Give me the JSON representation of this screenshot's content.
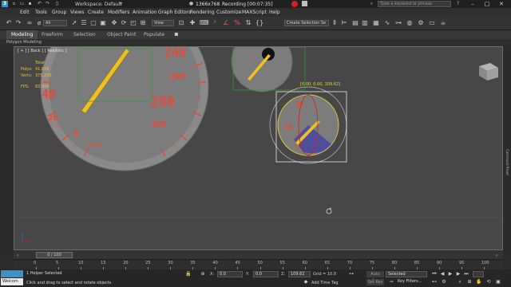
{
  "titlebar": {
    "app_icon": "3ds-max-logo",
    "workspace": "Workspace: Default",
    "recording_dims": "1366x768",
    "recording_status": "Recording [00:07:35]",
    "search_placeholder": "Type a keyword or phrase"
  },
  "menus": [
    "Edit",
    "Tools",
    "Group",
    "Views",
    "Create",
    "Modifiers",
    "Animation",
    "Graph Editors",
    "Rendering",
    "Customize",
    "MAXScript",
    "Help"
  ],
  "toolbar": {
    "selection_filter": "All",
    "view_dropdown": "View",
    "selection_set": "Create Selection Se"
  },
  "ribbon": {
    "tabs": [
      "Modeling",
      "Freeform",
      "Selection",
      "Object Paint",
      "Populate"
    ],
    "active_tab": "Modeling",
    "subpanel": "Polygon Modeling"
  },
  "viewport": {
    "label": "[ + ] [ Back ] [ Realistic ]",
    "stats": {
      "total_label": "Total",
      "polys_label": "Polys:",
      "polys_value": "41,676",
      "verts_label": "Verts:",
      "verts_value": "375,256",
      "fps_label": "FPS:",
      "fps_value": "82.956"
    },
    "gizmo_coords": "[0.00, 0.00, 109.62]",
    "big_gauge_numbers": [
      "240",
      "260",
      "280",
      "300",
      "40",
      "20",
      "0"
    ],
    "big_gauge_brand": "koneds",
    "small_gauge_numbers": [
      "2",
      "4"
    ],
    "selected_gauge_numbers": [
      "16",
      "12",
      "8"
    ],
    "right_panel_label": "Command Panel"
  },
  "timeline": {
    "frame_display": "0 / 100",
    "ticks": [
      "0",
      "5",
      "10",
      "15",
      "20",
      "25",
      "30",
      "35",
      "40",
      "45",
      "50",
      "55",
      "60",
      "65",
      "70",
      "75",
      "80",
      "85",
      "90",
      "95",
      "100"
    ]
  },
  "status": {
    "welcome": "Welcom",
    "selection": "1 Helper Selected",
    "hint": "Click and drag to select and rotate objects",
    "x_label": "X:",
    "x_value": "0.0",
    "y_label": "Y:",
    "y_value": "0.0",
    "z_label": "Z:",
    "z_value": "109.62",
    "grid": "Grid = 10.0",
    "add_time_tag": "Add Time Tag",
    "auto_key": "Auto Key",
    "set_key": "Set Key",
    "selected_dropdown": "Selected",
    "key_filters": "Key Filters..."
  },
  "colors": {
    "accent": "#3a93c4",
    "gauge_numbers": "#e8483a",
    "needle": "#f0c020",
    "stats_text": "#e8c040",
    "gizmo_yellow": "#e8d23a",
    "record": "#d02020"
  }
}
